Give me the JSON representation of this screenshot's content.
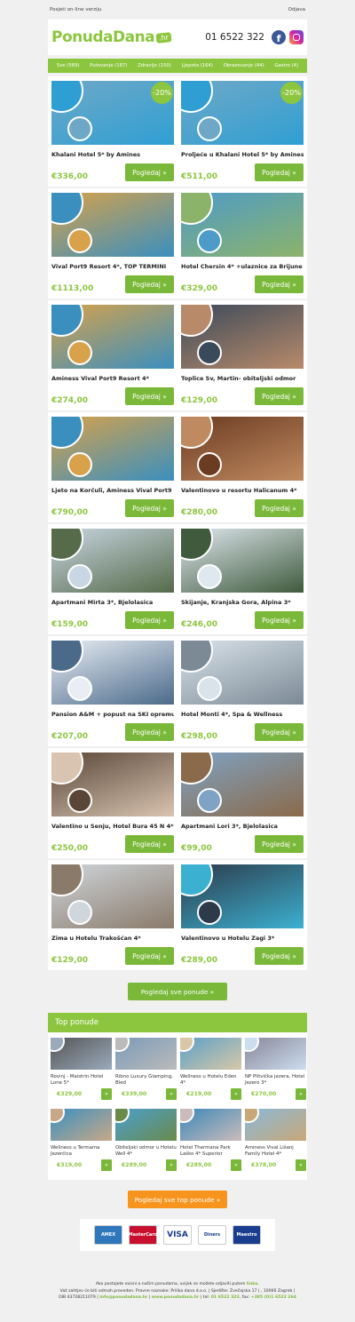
{
  "toplinks": {
    "online": "Posjeti on-line verziju",
    "unsubscribe": "Odjava"
  },
  "header": {
    "logo_main": "PonudaDana",
    "logo_tld": ".hr",
    "phone": "01 6522 322",
    "fb": "f"
  },
  "categories": [
    "Sve (569)",
    "Putovanja (187)",
    "Zdravlje (150)",
    "Ljepota (164)",
    "Obrazovanje (44)",
    "Gastro (4)"
  ],
  "offers": [
    {
      "title": "Khalani Hotel 5* by Amines",
      "price": "€336,00",
      "badge": "-20%",
      "btn": "Pogledaj »",
      "c1": "#6fa8c7",
      "c2": "#2f9fd3"
    },
    {
      "title": "Proljeće u Khalani Hotel 5* by Amines",
      "price": "€511,00",
      "badge": "-20%",
      "btn": "Pogledaj »",
      "c1": "#6fa8c7",
      "c2": "#2f9fd3"
    },
    {
      "title": "Vival Port9 Resort 4*, TOP TERMINI",
      "price": "€1113,00",
      "btn": "Pogledaj »",
      "c1": "#d7a24a",
      "c2": "#3a8fbf"
    },
    {
      "title": "Hotel Chersin 4* +ulaznice za Brijune",
      "price": "€329,00",
      "btn": "Pogledaj »",
      "c1": "#4d9bc8",
      "c2": "#8cb36a"
    },
    {
      "title": "Aminess Vival Port9 Resort 4*",
      "price": "€274,00",
      "btn": "Pogledaj »",
      "c1": "#d7a24a",
      "c2": "#3a8fbf"
    },
    {
      "title": "Toplice Sv, Martin- obiteljski odmor",
      "price": "€129,00",
      "btn": "Pogledaj »",
      "c1": "#3b4a5a",
      "c2": "#b88a6a"
    },
    {
      "title": "Ljeto na Korčuli, Aminess Vival Port9",
      "price": "€790,00",
      "btn": "Pogledaj »",
      "c1": "#d7a24a",
      "c2": "#3a8fbf"
    },
    {
      "title": "Valentinovo u resortu Halicanum 4*",
      "price": "€280,00",
      "btn": "Pogledaj »",
      "c1": "#6b3b22",
      "c2": "#c08a60"
    },
    {
      "title": "Apartmani Mirta 3*, Bjelolasica",
      "price": "€159,00",
      "btn": "Pogledaj »",
      "c1": "#c9d6e3",
      "c2": "#556b4a"
    },
    {
      "title": "Skijanje, Kranjska Gora, Alpina 3*",
      "price": "€246,00",
      "btn": "Pogledaj »",
      "c1": "#dfe8ef",
      "c2": "#3f5a3c"
    },
    {
      "title": "Pansion A&M + popust na SKI opremu",
      "price": "€207,00",
      "btn": "Pogledaj »",
      "c1": "#e9eef4",
      "c2": "#4b6a8a"
    },
    {
      "title": "Hotel Monti 4*, Spa & Wellness",
      "price": "€298,00",
      "btn": "Pogledaj »",
      "c1": "#d9e3ea",
      "c2": "#7c8a96"
    },
    {
      "title": "Valentino u Senju, Hotel Bura 45 N 4*",
      "price": "€250,00",
      "btn": "Pogledaj »",
      "c1": "#5a4638",
      "c2": "#d8c4b0"
    },
    {
      "title": "Apartmani Lori 3*, Bjelolasica",
      "price": "€99,00",
      "btn": "Pogledaj »",
      "c1": "#7fa3c4",
      "c2": "#8a6a4a"
    },
    {
      "title": "Zima u Hotelu Trakošćan 4*",
      "price": "€129,00",
      "btn": "Pogledaj »",
      "c1": "#cfd6dc",
      "c2": "#8a7a6a"
    },
    {
      "title": "Valentinovo u Hotelu Zagi 3*",
      "price": "€289,00",
      "btn": "Pogledaj »",
      "c1": "#2d3a4a",
      "c2": "#3bb0d0"
    }
  ],
  "all_offers": "Pogledaj sve ponude »",
  "top": {
    "heading": "Top ponude",
    "items": [
      {
        "title": "Rovinj - Maistrin Hotel Lone 5*",
        "price": "€329,00",
        "c1": "#555",
        "c2": "#9ab"
      },
      {
        "title": "Ribno Luxury Glamping, Bled",
        "price": "€339,00",
        "c1": "#7a9ab8",
        "c2": "#bbb"
      },
      {
        "title": "Wellness u Hotelu Eden 4*",
        "price": "€219,00",
        "c1": "#5aa0c8",
        "c2": "#d8c8a8"
      },
      {
        "title": "NP Plitvička jezera, Hotel Jezero 3*",
        "price": "€270,00",
        "c1": "#889",
        "c2": "#cde"
      },
      {
        "title": "Wellness u Termama Jezerčica",
        "price": "€319,00",
        "c1": "#3a90c0",
        "c2": "#c8a888"
      },
      {
        "title": "Obiteljski odmor u Hotelu Well 4*",
        "price": "€289,00",
        "c1": "#4aa0d0",
        "c2": "#6a8a4a"
      },
      {
        "title": "Hotel Thermana Park Laško 4* Superior",
        "price": "€289,00",
        "c1": "#3a88b8",
        "c2": "#cbb"
      },
      {
        "title": "Aminess Vival Lišanj Family Hotel 4*",
        "price": "€378,00",
        "c1": "#8ab8d8",
        "c2": "#c8a878"
      }
    ],
    "btn": "»"
  },
  "top_all": "Pogledaj sve top ponude »",
  "payments": [
    {
      "name": "AMEX",
      "bg": "#2e77bc"
    },
    {
      "name": "MasterCard",
      "bg": "#c8102e"
    },
    {
      "name": "VISA",
      "bg": "#ffffff"
    },
    {
      "name": "Diners",
      "bg": "#ffffff"
    },
    {
      "name": "Maestro",
      "bg": "#1a3d8f"
    }
  ],
  "footer": {
    "line1a": "Ako postajete ovisni o našim ponudama, uvijek se možete odjaviti putem ",
    "line1b": "linka.",
    "line2": "Važ zahtjev će biti odmah proveden. Pravne naznake: Prilika dana d.o.o. | Sjedište: Zvečajska 17 | , 10000 Zagreb |",
    "line3a": "OIB 43728211079 | ",
    "email": "info@ponudadana.hr",
    "sep": " | ",
    "web": "www.ponudadana.hr",
    "tel_label": " | tel: ",
    "tel": "01 6522 322",
    "fax_label": ", fax: ",
    "fax": "+385 (0)1 6522 264"
  }
}
